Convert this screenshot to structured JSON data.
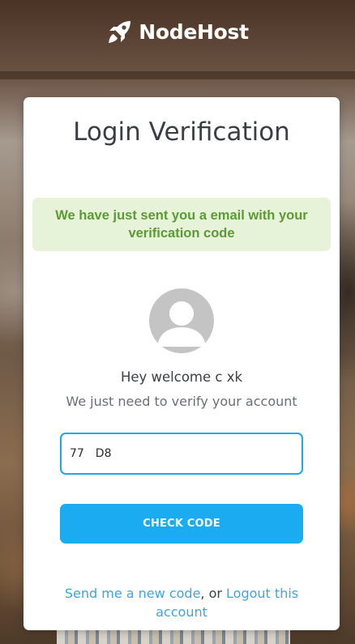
{
  "brand": {
    "name": "NodeHost",
    "icon": "rocket-icon"
  },
  "page": {
    "title": "Login Verification",
    "alert_message": "We have just sent you a email with your verification code",
    "avatar_icon": "user-avatar-icon",
    "greeting": "Hey welcome c xk",
    "subtext": "We just need to verify your account"
  },
  "form": {
    "code_value": "77     D8",
    "submit_label": "CHECK CODE"
  },
  "footer": {
    "resend_link": "Send me a new code",
    "separator": ", or",
    "logout_link": "Logout this account"
  },
  "colors": {
    "accent": "#1aabf0",
    "alert_bg": "#e6f3d8",
    "alert_text": "#5b9a34",
    "link": "#3aa6dd"
  }
}
